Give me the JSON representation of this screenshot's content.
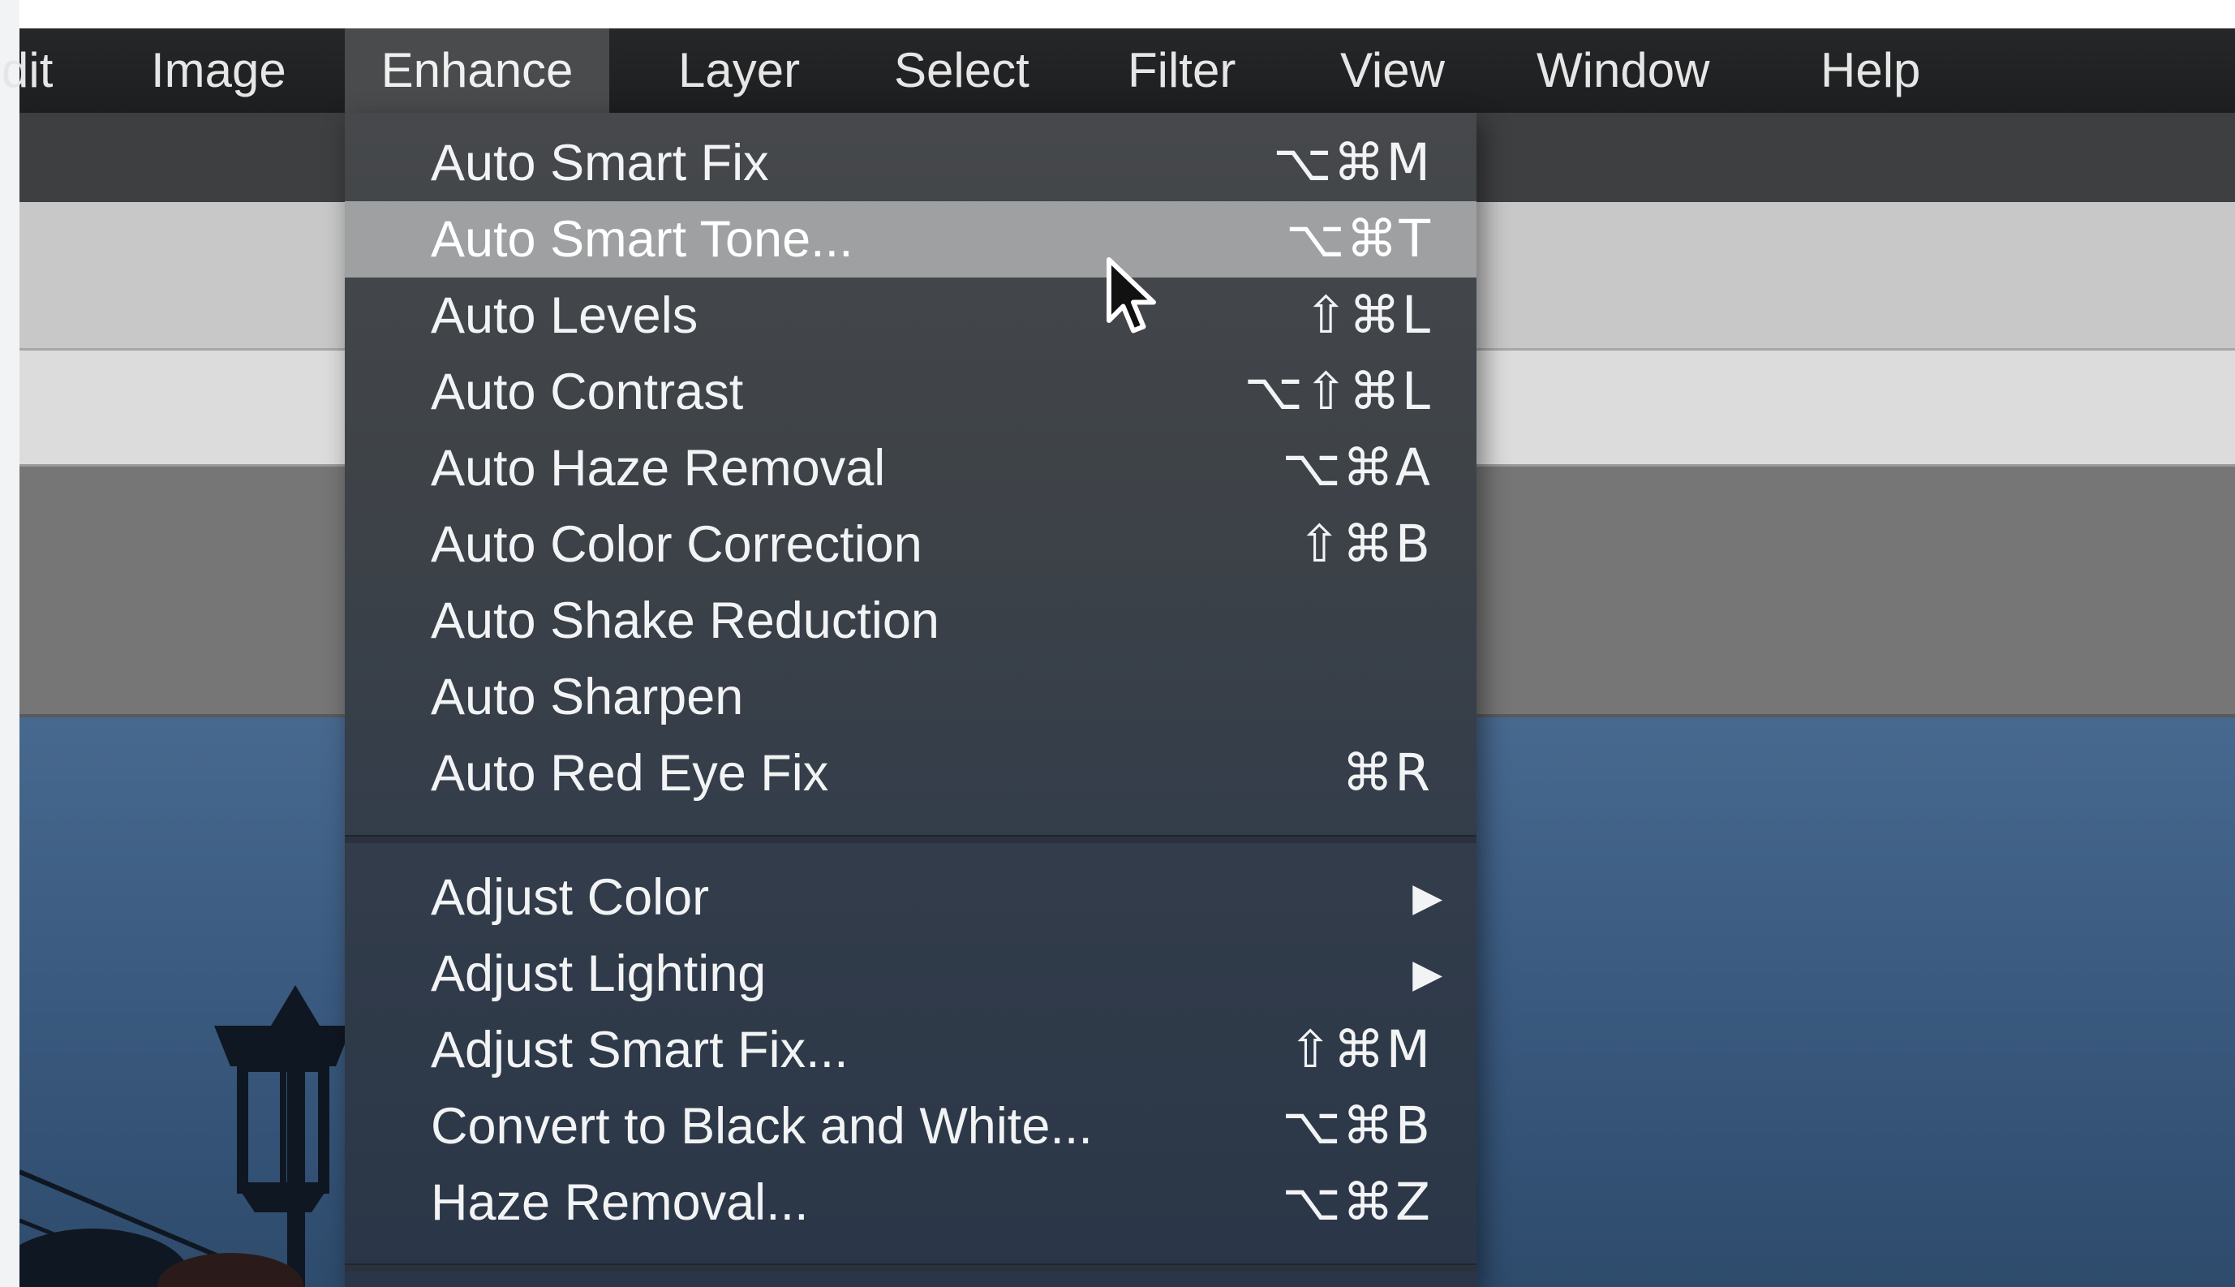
{
  "menubar": {
    "items": [
      {
        "label": "dit",
        "active": false
      },
      {
        "label": "Image",
        "active": false
      },
      {
        "label": "Enhance",
        "active": true
      },
      {
        "label": "Layer",
        "active": false
      },
      {
        "label": "Select",
        "active": false
      },
      {
        "label": "Filter",
        "active": false
      },
      {
        "label": "View",
        "active": false
      },
      {
        "label": "Window",
        "active": false
      },
      {
        "label": "Help",
        "active": false
      }
    ]
  },
  "enhance_menu": {
    "items": [
      {
        "label": "Auto Smart Fix",
        "shortcut": "⌥⌘M"
      },
      {
        "label": "Auto Smart Tone...",
        "shortcut": "⌥⌘T",
        "highlighted": true
      },
      {
        "label": "Auto Levels",
        "shortcut": "⇧⌘L"
      },
      {
        "label": "Auto Contrast",
        "shortcut": "⌥⇧⌘L"
      },
      {
        "label": "Auto Haze Removal",
        "shortcut": "⌥⌘A"
      },
      {
        "label": "Auto Color Correction",
        "shortcut": "⇧⌘B"
      },
      {
        "label": "Auto Shake Reduction",
        "shortcut": ""
      },
      {
        "label": "Auto Sharpen",
        "shortcut": ""
      },
      {
        "label": "Auto Red Eye Fix",
        "shortcut": "⌘R"
      },
      {
        "label": "Adjust Color",
        "submenu": true
      },
      {
        "label": "Adjust Lighting",
        "submenu": true
      },
      {
        "label": "Adjust Smart Fix...",
        "shortcut": "⇧⌘M"
      },
      {
        "label": "Convert to Black and White...",
        "shortcut": "⌥⌘B"
      },
      {
        "label": "Haze Removal...",
        "shortcut": "⌥⌘Z"
      }
    ],
    "submenu_arrow": "▶"
  },
  "colors": {
    "menubar_bg": "#1d1e1f",
    "menu_bg": "#3d4248",
    "highlight": "#9fa0a2",
    "photo_sky": "#3c5c82"
  },
  "icons": {
    "cursor": "arrow-cursor-icon",
    "submenu": "submenu-arrow-icon"
  }
}
